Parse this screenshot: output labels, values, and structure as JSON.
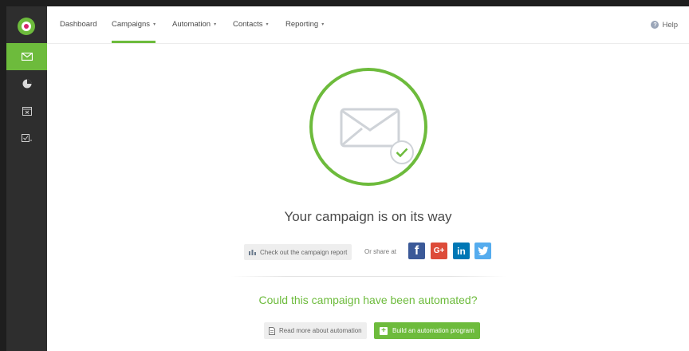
{
  "nav": {
    "items": [
      {
        "label": "Dashboard",
        "has_caret": false
      },
      {
        "label": "Campaigns",
        "has_caret": true,
        "active": true
      },
      {
        "label": "Automation",
        "has_caret": true
      },
      {
        "label": "Contacts",
        "has_caret": true
      },
      {
        "label": "Reporting",
        "has_caret": true
      }
    ],
    "help_label": "Help",
    "caret": "▾"
  },
  "sidebar": {
    "logo": "logo-icon",
    "items": [
      {
        "icon": "envelope-icon",
        "active": true
      },
      {
        "icon": "pie-chart-icon"
      },
      {
        "icon": "calendar-icon"
      },
      {
        "icon": "list-check-icon"
      }
    ]
  },
  "main": {
    "headline": "Your campaign is on its way",
    "report_button": "Check out the campaign report",
    "share_label": "Or share at",
    "social": {
      "facebook": "f",
      "google_plus": "G+",
      "linkedin": "in",
      "twitter": "t"
    },
    "question": "Could this campaign have been automated?",
    "read_button": "Read more about automation",
    "build_button": "Build an automation program"
  },
  "colors": {
    "accent": "#6dbb3c",
    "sidebar": "#2e2e2e",
    "facebook": "#3b5998",
    "google_plus": "#dd4b39",
    "linkedin": "#0077b5",
    "twitter": "#55acee"
  }
}
